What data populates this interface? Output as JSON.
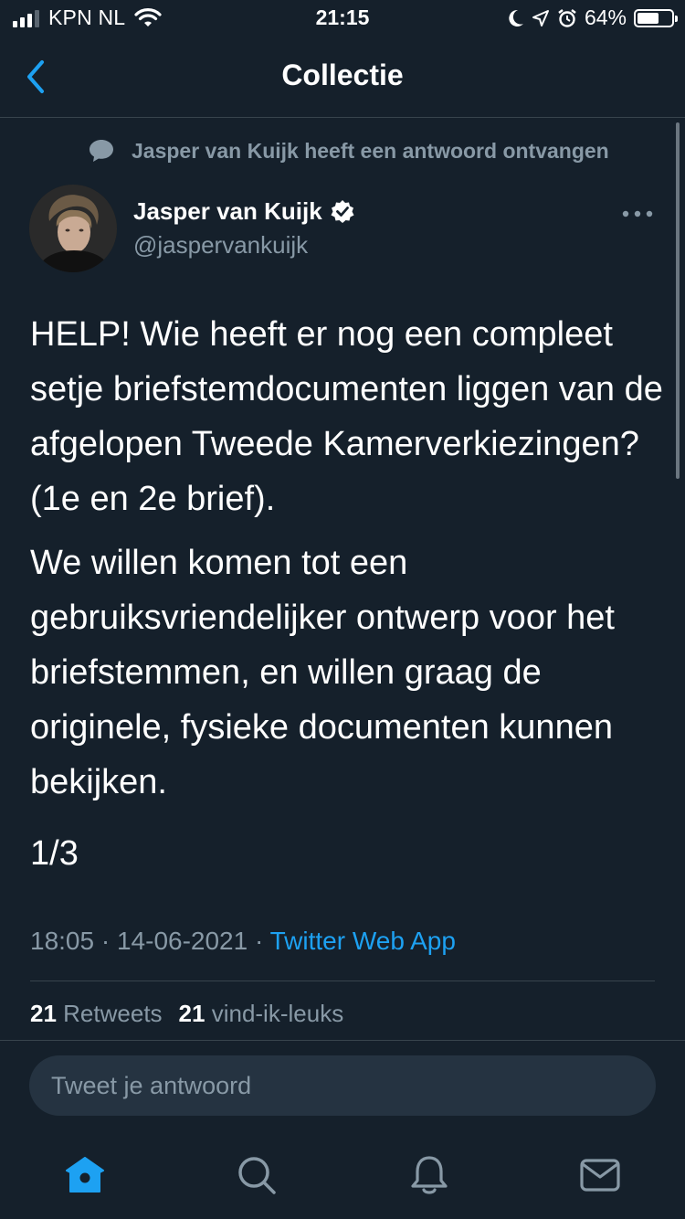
{
  "status_bar": {
    "carrier": "KPN NL",
    "time": "21:15",
    "battery_percent": "64%",
    "battery_level": 0.64
  },
  "nav": {
    "title": "Collectie"
  },
  "tweet": {
    "context": "Jasper van Kuijk heeft een antwoord ontvangen",
    "author_name": "Jasper van Kuijk",
    "author_handle": "@jaspervankuijk",
    "paragraphs": [
      "HELP! Wie heeft er nog een compleet setje briefstemdocumenten liggen van de afgelopen Tweede Kamerverkiezingen? (1e en 2e brief).",
      "We willen komen tot een gebruiksvriendelijker ontwerp voor het briefstemmen, en willen graag de originele, fysieke documenten kunnen bekijken.",
      "1/3"
    ],
    "time": "18:05",
    "date": "14-06-2021",
    "separator": "·",
    "source": "Twitter Web App",
    "retweets_count": "21",
    "retweets_label": "Retweets",
    "likes_count": "21",
    "likes_label": "vind-ik-leuks"
  },
  "reply": {
    "placeholder": "Tweet je antwoord"
  },
  "tabbar": {
    "items": [
      "home-icon",
      "search-icon",
      "notifications-icon",
      "messages-icon"
    ],
    "active_color": "#1da1f2",
    "inactive_color": "#8899a6"
  },
  "colors": {
    "background": "#15202b",
    "accent": "#1da1f2",
    "secondary_text": "#8899a6"
  }
}
